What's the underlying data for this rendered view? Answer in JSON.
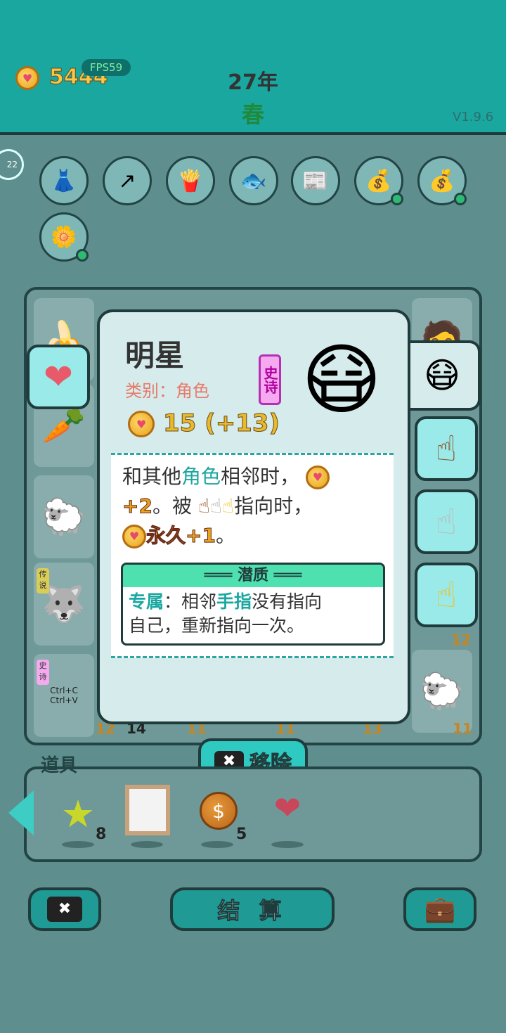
{
  "header": {
    "coins": "5444",
    "fps": "FPS59",
    "year": "27年",
    "season": "春",
    "version": "V1.9.6",
    "round_badge": "22"
  },
  "relics": [
    {
      "icon": "skirt-icon",
      "glyph": "👗",
      "dot": false
    },
    {
      "icon": "arrow-up-icon",
      "glyph": "↗",
      "dot": false
    },
    {
      "icon": "fries-icon",
      "glyph": "🍟",
      "dot": false
    },
    {
      "icon": "fishbowl-icon",
      "glyph": "🐟",
      "dot": false
    },
    {
      "icon": "time-magazine-icon",
      "glyph": "📰",
      "dot": false
    },
    {
      "icon": "money-bag-icon",
      "glyph": "💰",
      "dot": true
    },
    {
      "icon": "money-bag-icon",
      "glyph": "💰",
      "dot": true
    },
    {
      "icon": "potted-flower-icon",
      "glyph": "🌼",
      "dot": true
    }
  ],
  "grid": {
    "numbers": [
      "12",
      "14",
      "11",
      "11",
      "13",
      "11",
      "12"
    ],
    "tags": [
      "传说",
      "史诗"
    ],
    "clipboard": "Ctrl+C\nCtrl+V"
  },
  "card": {
    "title": "明星",
    "category": "类别：角色",
    "rarity": "史诗",
    "value": "15 (+13)",
    "desc": {
      "l1_a": "和其他",
      "l1_b": "角色",
      "l1_c": "相邻时，",
      "l2_a": "+2",
      "l2_b": "。被",
      "l2_c": "指向时，",
      "l3_a": "永久+1",
      "l3_b": "。"
    },
    "trait_title": "潜质",
    "trait": {
      "a": "专属",
      "b": "：相邻",
      "c": "手指",
      "d": "没有指向",
      "e": "自己，重新指向一次。"
    }
  },
  "remove_label": "移除",
  "items": {
    "label": "道具",
    "list": [
      {
        "name": "star",
        "glyph": "⭐",
        "count": "8"
      },
      {
        "name": "frame",
        "glyph": "🖼",
        "count": ""
      },
      {
        "name": "coin",
        "glyph": "$",
        "count": "5"
      },
      {
        "name": "liver",
        "glyph": "🫀",
        "count": ""
      }
    ]
  },
  "bottom": {
    "settle_label": "结 算"
  },
  "colors": {
    "header_bg": "#1aa7a0",
    "accent_teal": "#2ec9c0",
    "gold": "#e8b92b",
    "rarity_purple": "#b000a0"
  }
}
